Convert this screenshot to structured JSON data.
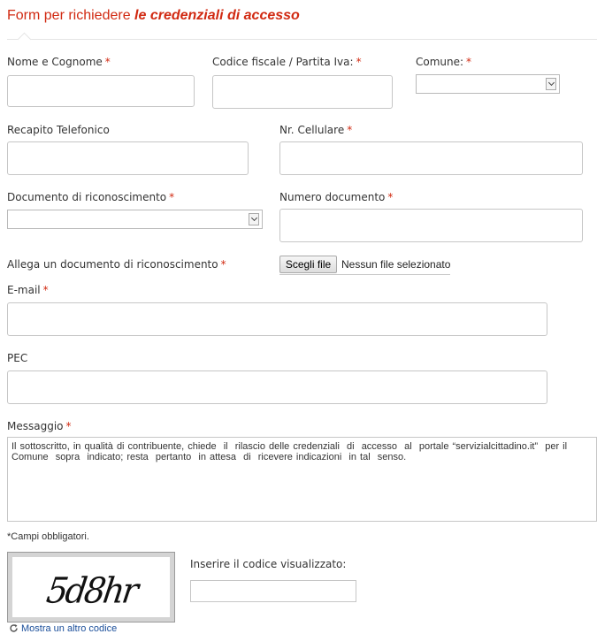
{
  "header": {
    "title_prefix": "Form per richiedere ",
    "title_emphasis": "le credenziali di accesso"
  },
  "form": {
    "nome": {
      "label": "Nome e Cognome",
      "value": ""
    },
    "codice_fiscale": {
      "label": "Codice fiscale / Partita Iva:",
      "value": ""
    },
    "comune": {
      "label": "Comune:",
      "selected": ""
    },
    "recapito": {
      "label": "Recapito Telefonico",
      "value": ""
    },
    "cellulare": {
      "label": "Nr. Cellulare",
      "value": ""
    },
    "documento": {
      "label": "Documento di riconoscimento",
      "selected": ""
    },
    "numero_documento": {
      "label": "Numero documento",
      "value": ""
    },
    "allegato": {
      "label": "Allega un documento di riconoscimento",
      "button_label": "Scegli file",
      "status": "Nessun file selezionato"
    },
    "email": {
      "label": "E-mail",
      "value": ""
    },
    "pec": {
      "label": "PEC",
      "value": ""
    },
    "messaggio": {
      "label": "Messaggio",
      "value": "Il sottoscritto, in qualità di contribuente, chiede  il  rilascio delle credenziali  di  accesso  al  portale “servizialcittadino.it”  per il Comune  sopra  indicato; resta  pertanto  in attesa  di  ricevere indicazioni  in tal  senso."
    },
    "required_marker": "*",
    "required_note": "*Campi obbligatori."
  },
  "captcha": {
    "code": "5d8hr",
    "input_label": "Inserire il codice visualizzato:",
    "input_value": "",
    "refresh_label": "Mostra un altro codice"
  },
  "colors": {
    "accent": "#d12a12",
    "link": "#1a4e9a"
  },
  "icons": {
    "refresh": "refresh-icon",
    "dropdown": "chevron-down-icon"
  }
}
